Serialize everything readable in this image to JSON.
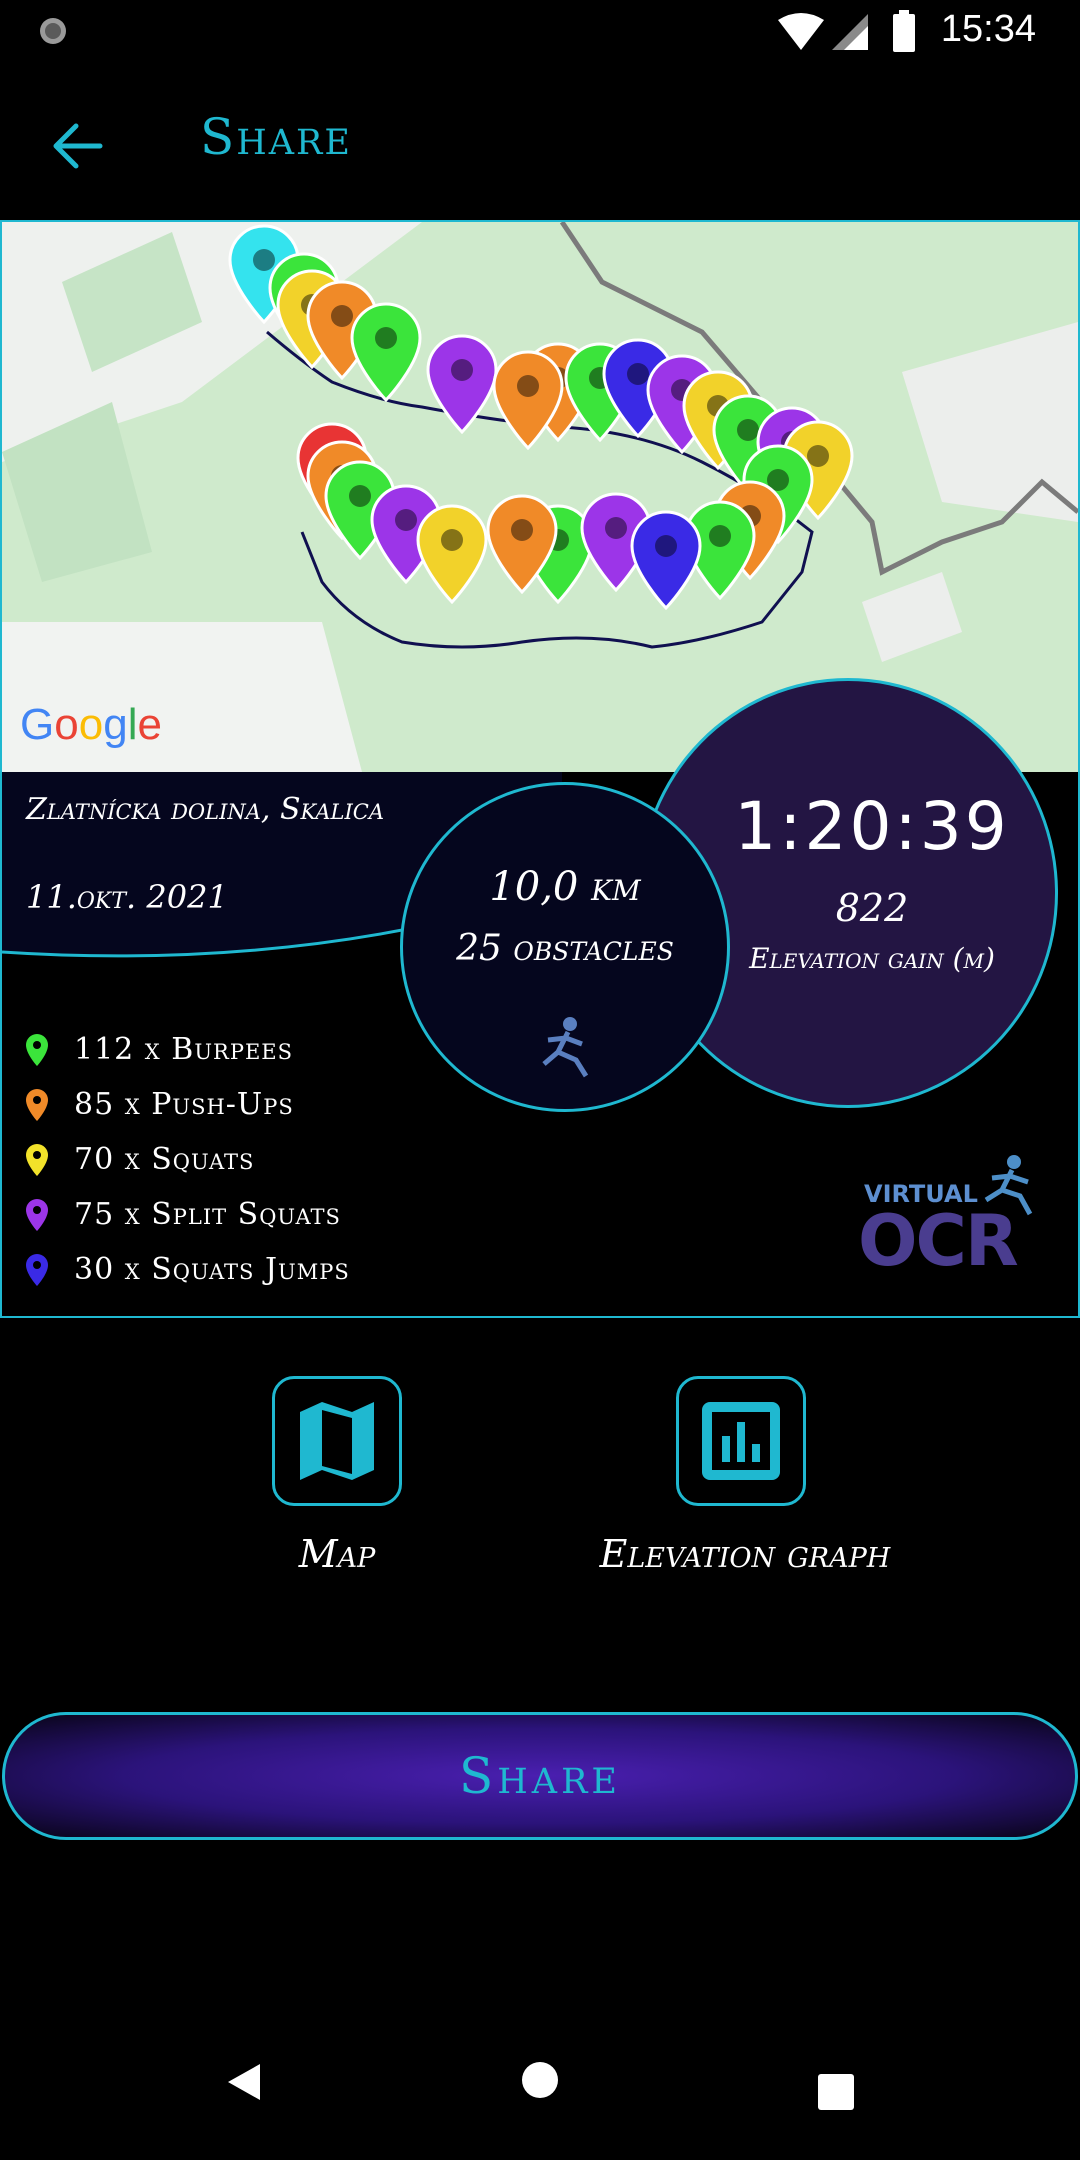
{
  "status_bar": {
    "time": "15:34"
  },
  "app_bar": {
    "title": "Share"
  },
  "location": {
    "name": "Zlatnícka dolina, Skalica",
    "date": "11.okt. 2021"
  },
  "stats": {
    "distance": "10,0 km",
    "obstacles": "25 obstacles",
    "duration": "1:20:39",
    "elevation_value": "822",
    "elevation_label": "Elevation gain (m)"
  },
  "exercises": [
    {
      "label": "112 x Burpees",
      "color": "#3be43b"
    },
    {
      "label": "85 x Push-Ups",
      "color": "#f08a28"
    },
    {
      "label": "70 x Squats",
      "color": "#f2e22a"
    },
    {
      "label": "75 x Split Squats",
      "color": "#9c35e8"
    },
    {
      "label": "30 x Squats Jumps",
      "color": "#3a2ae6"
    }
  ],
  "map": {
    "attribution": "Google"
  },
  "logo": {
    "line1": "VIRTUAL",
    "line2": "OCR"
  },
  "tools": {
    "map_label": "Map",
    "graph_label": "Elevation graph"
  },
  "share_button": {
    "label": "Share"
  },
  "colors": {
    "accent": "#1fb8d0",
    "band": "#05061e",
    "circle": "#231543"
  }
}
